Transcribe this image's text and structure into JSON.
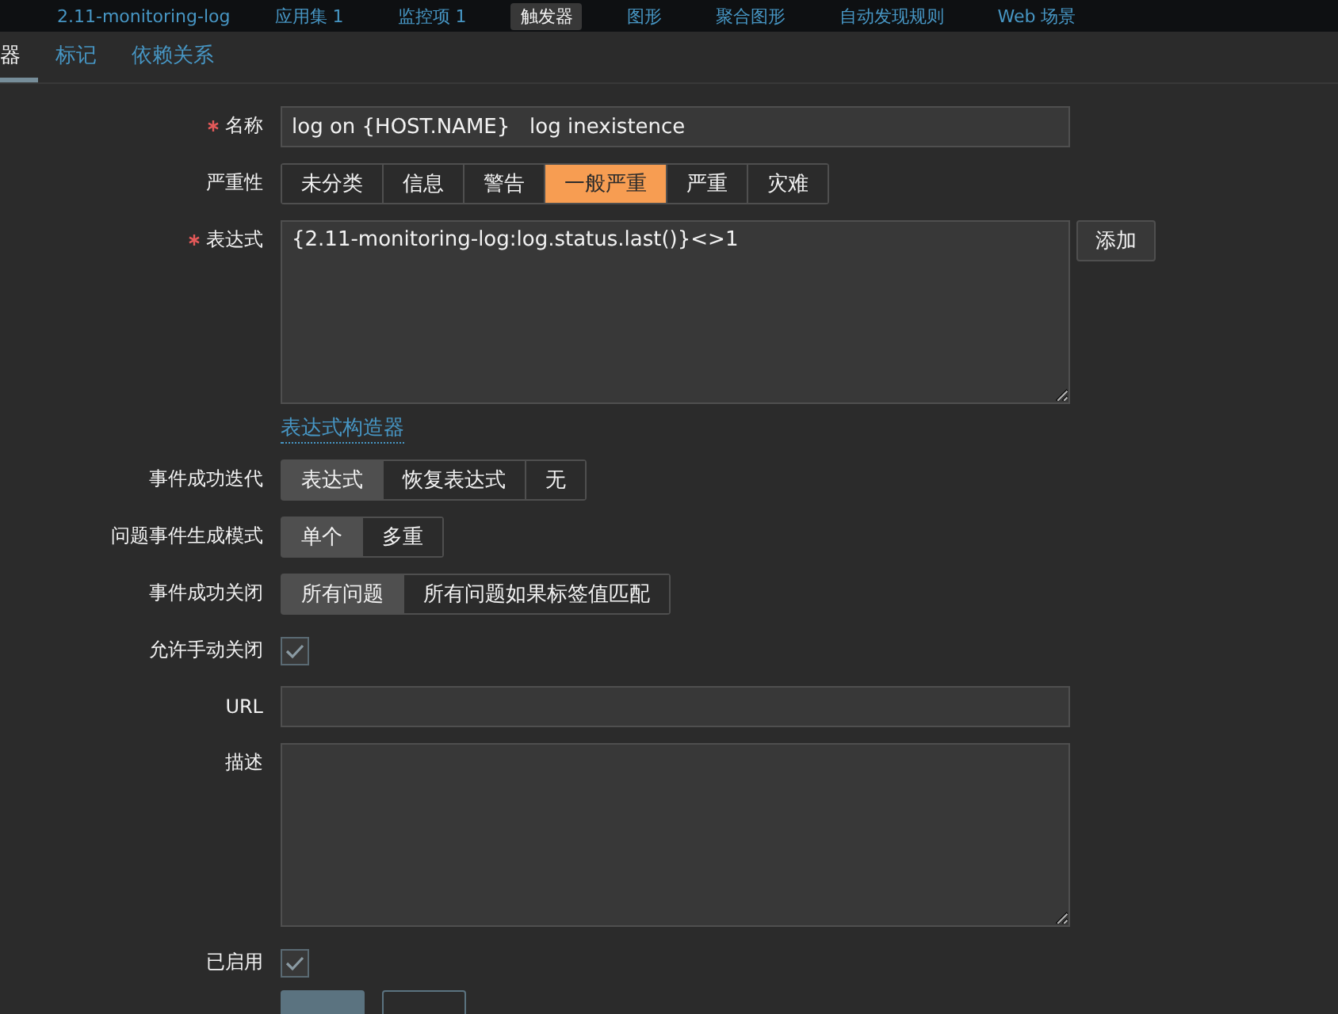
{
  "top_nav": {
    "breadcrumb": "2.11-monitoring-log",
    "items": [
      {
        "label": "应用集 1",
        "selected": false
      },
      {
        "label": "监控项 1",
        "selected": false
      },
      {
        "label": "触发器",
        "selected": true
      },
      {
        "label": "图形",
        "selected": false
      },
      {
        "label": "聚合图形",
        "selected": false
      },
      {
        "label": "自动发现规则",
        "selected": false
      },
      {
        "label": "Web 场景",
        "selected": false
      }
    ]
  },
  "tabs": [
    {
      "label": "器",
      "selected": true
    },
    {
      "label": "标记",
      "selected": false
    },
    {
      "label": "依赖关系",
      "selected": false
    }
  ],
  "form": [
    {
      "kind": "input",
      "label": "名称",
      "required": true,
      "value": "log on {HOST.NAME}   log inexistence"
    },
    {
      "kind": "segmented",
      "label": "严重性",
      "options": [
        {
          "label": "未分类",
          "selected": false
        },
        {
          "label": "信息",
          "selected": false
        },
        {
          "label": "警告",
          "selected": false
        },
        {
          "label": "一般严重",
          "selected": true
        },
        {
          "label": "严重",
          "selected": false
        },
        {
          "label": "灾难",
          "selected": false
        }
      ]
    },
    {
      "kind": "textarea",
      "label": "表达式",
      "required": true,
      "value": "{2.11-monitoring-log:log.status.last()}<>1",
      "button": "添加",
      "link": "表达式构造器"
    },
    {
      "kind": "segmented",
      "label": "事件成功迭代",
      "options": [
        {
          "label": "表达式",
          "selected": true
        },
        {
          "label": "恢复表达式",
          "selected": false
        },
        {
          "label": "无",
          "selected": false
        }
      ]
    },
    {
      "kind": "segmented",
      "label": "问题事件生成模式",
      "options": [
        {
          "label": "单个",
          "selected": true
        },
        {
          "label": "多重",
          "selected": false
        }
      ]
    },
    {
      "kind": "segmented",
      "label": "事件成功关闭",
      "options": [
        {
          "label": "所有问题",
          "selected": true
        },
        {
          "label": "所有问题如果标签值匹配",
          "selected": false
        }
      ]
    },
    {
      "kind": "checkbox",
      "label": "允许手动关闭",
      "checked": true
    },
    {
      "kind": "input",
      "label": "URL",
      "required": false
    },
    {
      "kind": "textarea",
      "label": "描述",
      "required": false
    },
    {
      "kind": "checkbox",
      "label": "已启用",
      "checked": true
    }
  ]
}
